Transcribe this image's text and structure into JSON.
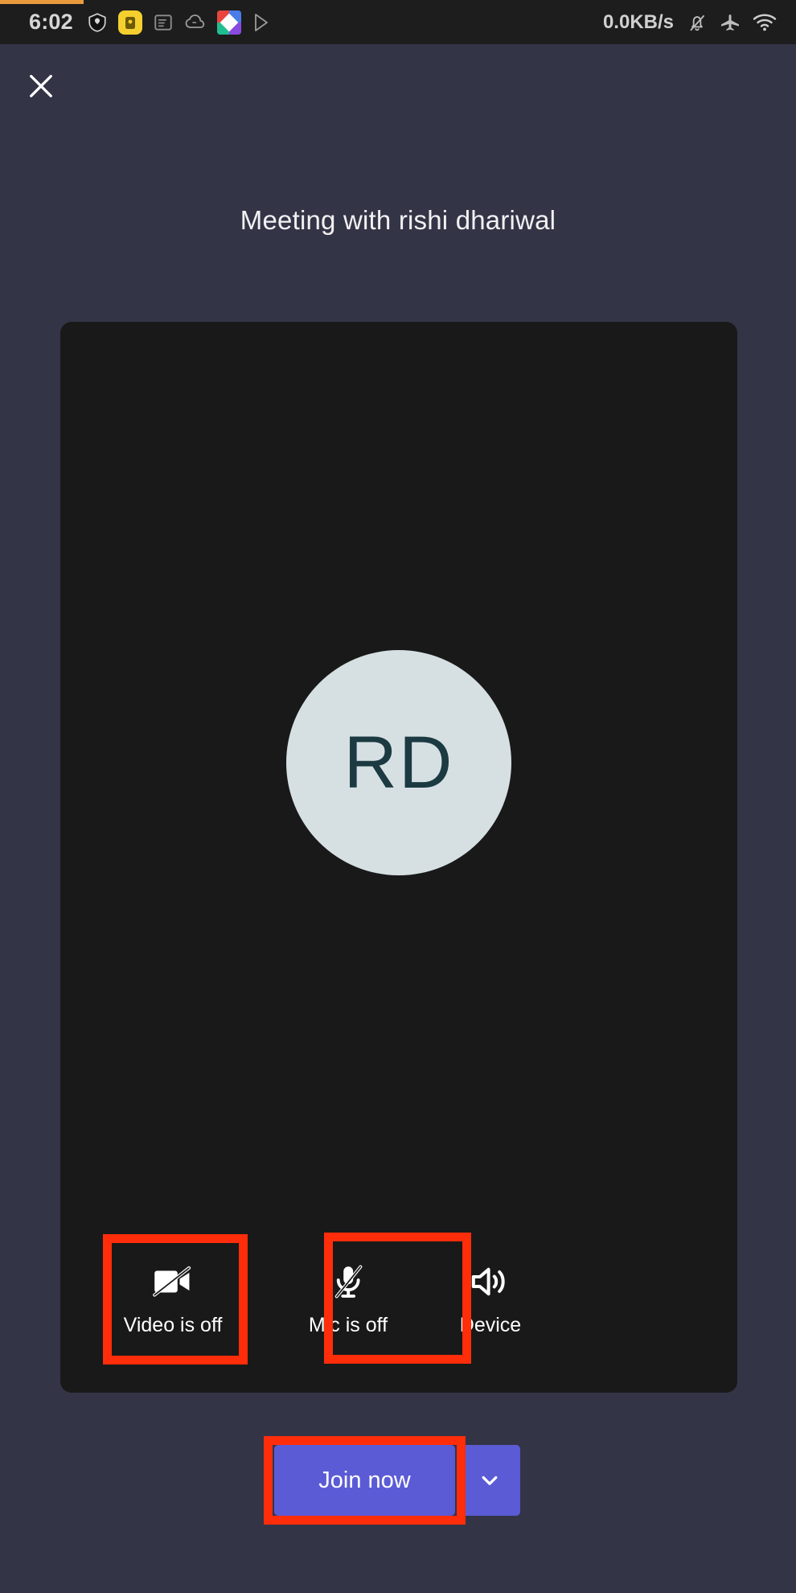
{
  "status_bar": {
    "time": "6:02",
    "network_speed": "0.0KB/s",
    "left_icons": [
      {
        "name": "shield-icon"
      },
      {
        "name": "yellow-app-icon"
      },
      {
        "name": "document-app-icon"
      },
      {
        "name": "cloud-icon"
      },
      {
        "name": "colorful-app-icon"
      },
      {
        "name": "play-store-icon"
      }
    ],
    "right_icons": [
      {
        "name": "bell-muted-icon"
      },
      {
        "name": "airplane-mode-icon"
      },
      {
        "name": "wifi-icon"
      }
    ]
  },
  "header": {
    "close_label": "close-icon",
    "meeting_title": "Meeting with rishi dhariwal"
  },
  "preview": {
    "avatar_initials": "RD",
    "avatar_bg": "#d6e0e3",
    "avatar_text_color": "#1b3a42",
    "panel_bg": "#191919"
  },
  "controls": [
    {
      "id": "video",
      "icon": "video-off-icon",
      "label": "Video is off",
      "highlighted": true
    },
    {
      "id": "mic",
      "icon": "mic-off-icon",
      "label": "Mic is off",
      "highlighted": true
    },
    {
      "id": "device",
      "icon": "speaker-icon",
      "label": "Device",
      "highlighted": false
    }
  ],
  "join": {
    "button_label": "Join now",
    "dropdown_icon": "chevron-down-icon",
    "accent_color": "#5b5bd6",
    "highlighted": true
  },
  "annotation": {
    "highlight_color": "#ff2d0a"
  },
  "progress": {
    "color": "#e89a3c"
  }
}
